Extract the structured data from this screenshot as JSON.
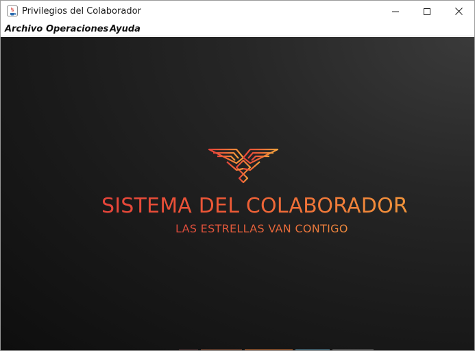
{
  "window": {
    "title": "Privilegios del Colaborador",
    "controls": {
      "minimize": "minimize-icon",
      "maximize": "maximize-icon",
      "close": "close-icon"
    }
  },
  "menubar": {
    "items": [
      {
        "label": "Archivo"
      },
      {
        "label": "Operaciones"
      },
      {
        "label": "Ayuda"
      }
    ]
  },
  "splash": {
    "logo": "eagle-logo-icon",
    "title": "SISTEMA DEL COLABORADOR",
    "subtitle": "LAS ESTRELLAS VAN CONTIGO"
  },
  "colors": {
    "accent_red": "#e5443a",
    "accent_orange": "#f39a3c",
    "background": "#1a1a1a"
  }
}
